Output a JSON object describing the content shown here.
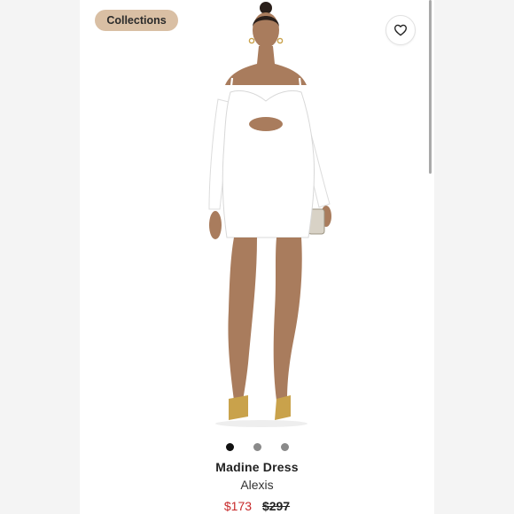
{
  "badge": {
    "label": "Collections"
  },
  "actions": {
    "like_icon": "heart-outline-icon"
  },
  "gallery": {
    "dots": [
      {
        "state": "active"
      },
      {
        "state": "inactive"
      },
      {
        "state": "inactive"
      }
    ]
  },
  "product": {
    "title": "Madine Dress",
    "brand": "Alexis",
    "sale_price": "$173",
    "original_price": "$297"
  },
  "colors": {
    "badge_bg": "#d9bfa4",
    "sale_price": "#c7292a",
    "dot_active": "#111111",
    "dot_inactive": "#8a8a8a"
  }
}
